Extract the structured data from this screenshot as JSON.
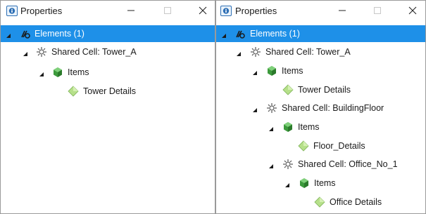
{
  "left_pane": {
    "title": "Properties",
    "tree": [
      {
        "label": "Elements (1)",
        "icon": "elements-icon",
        "expanded": true,
        "selected": true
      },
      {
        "label": "Shared Cell: Tower_A",
        "icon": "shared-cell-icon",
        "expanded": true
      },
      {
        "label": "Items",
        "icon": "items-icon",
        "expanded": true
      },
      {
        "label": "Tower Details",
        "icon": "details-icon"
      }
    ]
  },
  "right_pane": {
    "title": "Properties",
    "tree": [
      {
        "label": "Elements (1)",
        "icon": "elements-icon",
        "expanded": true,
        "selected": true
      },
      {
        "label": "Shared Cell: Tower_A",
        "icon": "shared-cell-icon",
        "expanded": true
      },
      {
        "label": "Items",
        "icon": "items-icon",
        "expanded": true
      },
      {
        "label": "Tower Details",
        "icon": "details-icon"
      },
      {
        "label": "Shared Cell: BuildingFloor",
        "icon": "shared-cell-icon",
        "expanded": true
      },
      {
        "label": "Items",
        "icon": "items-icon",
        "expanded": true
      },
      {
        "label": "Floor_Details",
        "icon": "details-icon"
      },
      {
        "label": "Shared Cell: Office_No_1",
        "icon": "shared-cell-icon",
        "expanded": true
      },
      {
        "label": "Items",
        "icon": "items-icon",
        "expanded": true
      },
      {
        "label": "Office Details",
        "icon": "details-icon"
      }
    ]
  },
  "colors": {
    "selection": "#1e90e8",
    "items_icon": "#3c9a3c",
    "details_icon": "#b6e08a"
  }
}
